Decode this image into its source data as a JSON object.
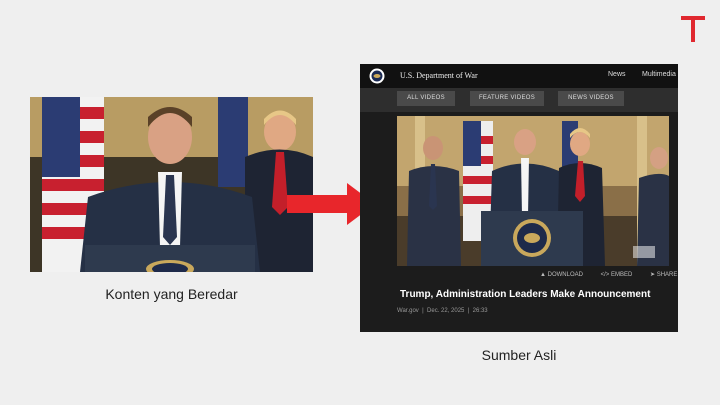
{
  "brand": {
    "logo_letter": "T",
    "accent": "#e0282f"
  },
  "left": {
    "caption": "Konten yang Beredar"
  },
  "right": {
    "caption": "Sumber Asli",
    "site_title": "U.S. Department of War",
    "nav": {
      "news": "News",
      "multimedia": "Multimedia"
    },
    "tabs": [
      "ALL VIDEOS",
      "FEATURE VIDEOS",
      "NEWS VIDEOS"
    ],
    "actions": {
      "download": "DOWNLOAD",
      "embed": "EMBED",
      "share": "SHARE"
    },
    "video_title": "Trump, Administration Leaders Make Announcement",
    "meta_author": "War.gov",
    "meta_date": "Dec. 22, 2025",
    "meta_duration": "26:33"
  },
  "colors": {
    "arrow": "#e8262b",
    "dark_bg": "#1c1c1c",
    "header_bg": "#111111"
  }
}
